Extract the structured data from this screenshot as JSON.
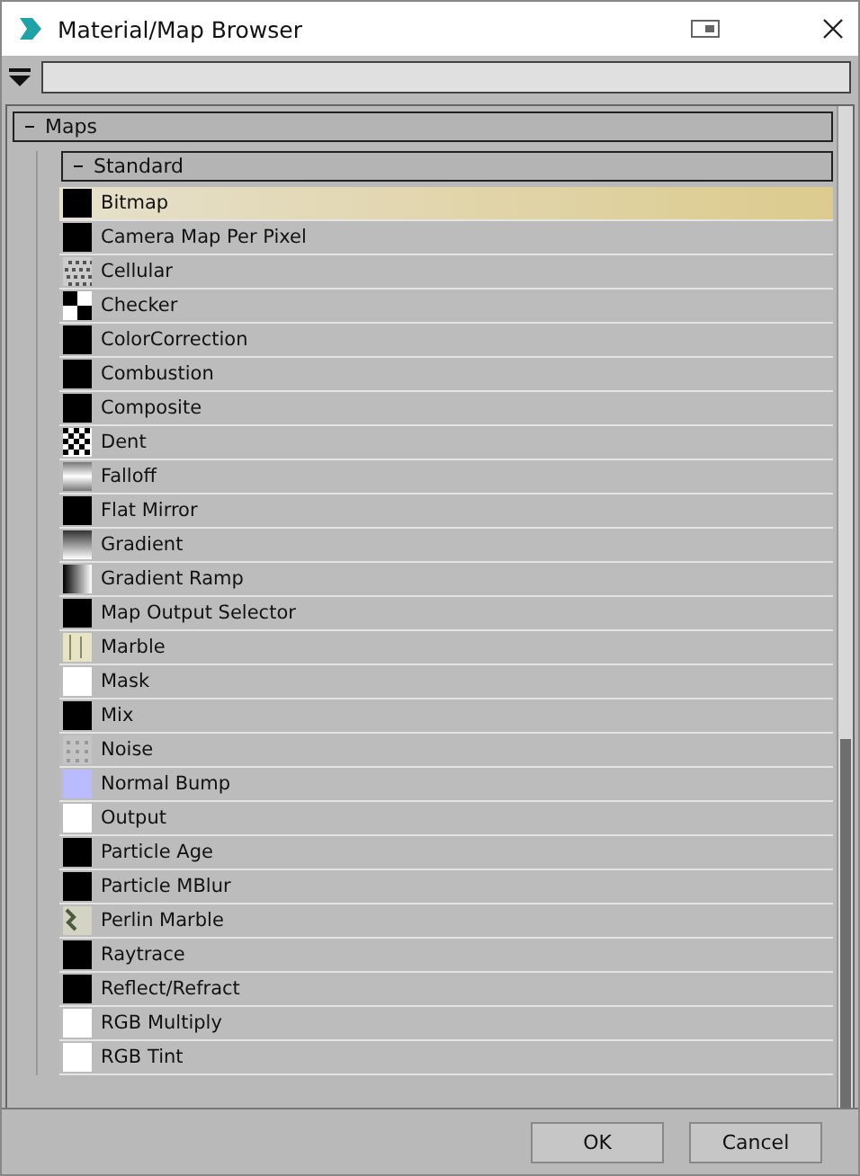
{
  "window": {
    "title": "Material/Map Browser"
  },
  "groups": [
    {
      "label": "Maps",
      "expanded": true,
      "children": [
        {
          "label": "Standard",
          "expanded": true,
          "items": [
            {
              "name": "Bitmap",
              "kind": "black",
              "selected": true
            },
            {
              "name": "Camera Map Per Pixel",
              "kind": "black",
              "selected": false
            },
            {
              "name": "Cellular",
              "kind": "noise",
              "selected": false
            },
            {
              "name": "Checker",
              "kind": "checker",
              "selected": false
            },
            {
              "name": "ColorCorrection",
              "kind": "black",
              "selected": false
            },
            {
              "name": "Combustion",
              "kind": "black",
              "selected": false
            },
            {
              "name": "Composite",
              "kind": "black",
              "selected": false
            },
            {
              "name": "Dent",
              "kind": "dent",
              "selected": false
            },
            {
              "name": "Falloff",
              "kind": "falloff",
              "selected": false
            },
            {
              "name": "Flat Mirror",
              "kind": "black",
              "selected": false
            },
            {
              "name": "Gradient",
              "kind": "gradient",
              "selected": false
            },
            {
              "name": "Gradient Ramp",
              "kind": "ramp",
              "selected": false
            },
            {
              "name": "Map Output Selector",
              "kind": "black",
              "selected": false
            },
            {
              "name": "Marble",
              "kind": "marble",
              "selected": false
            },
            {
              "name": "Mask",
              "kind": "white",
              "selected": false
            },
            {
              "name": "Mix",
              "kind": "black",
              "selected": false
            },
            {
              "name": "Noise",
              "kind": "softnoise",
              "selected": false
            },
            {
              "name": "Normal Bump",
              "kind": "lavender",
              "selected": false
            },
            {
              "name": "Output",
              "kind": "white",
              "selected": false
            },
            {
              "name": "Particle Age",
              "kind": "black",
              "selected": false
            },
            {
              "name": "Particle MBlur",
              "kind": "black",
              "selected": false
            },
            {
              "name": "Perlin Marble",
              "kind": "perlin",
              "selected": false
            },
            {
              "name": "Raytrace",
              "kind": "black",
              "selected": false
            },
            {
              "name": "Reflect/Refract",
              "kind": "black",
              "selected": false
            },
            {
              "name": "RGB Multiply",
              "kind": "white",
              "selected": false
            },
            {
              "name": "RGB Tint",
              "kind": "white",
              "selected": false
            }
          ]
        }
      ]
    }
  ],
  "buttons": [
    "OK",
    "Cancel"
  ]
}
